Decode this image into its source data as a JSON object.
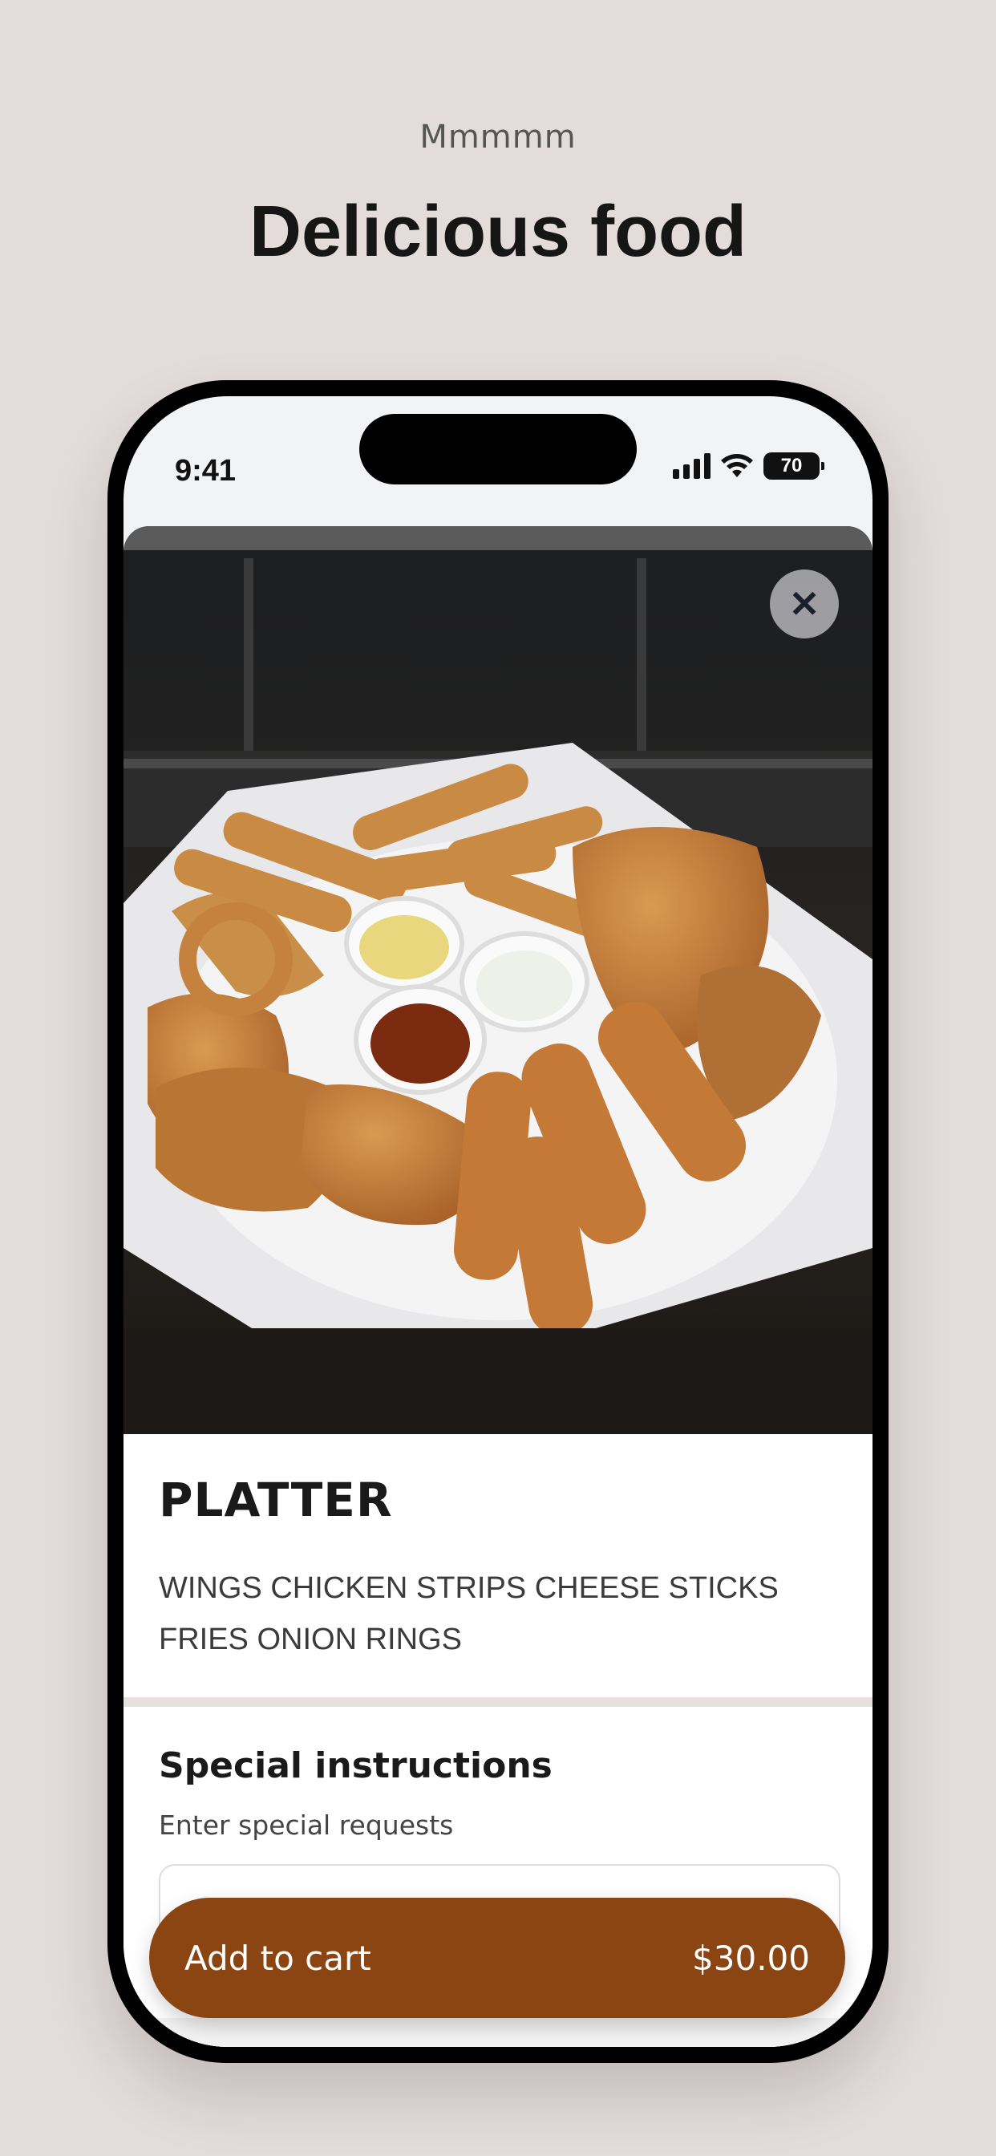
{
  "header": {
    "subtitle": "Mmmmm",
    "title": "Delicious food"
  },
  "status_bar": {
    "time": "9:41",
    "battery": "70"
  },
  "item": {
    "title": "PLATTER",
    "description": "WINGS CHICKEN STRIPS CHEESE STICKS FRIES ONION RINGS"
  },
  "special_instructions": {
    "title": "Special instructions",
    "subtitle": "Enter special requests"
  },
  "cart": {
    "label": "Add to cart",
    "price": "$30.00"
  },
  "colors": {
    "background": "#e4dcda",
    "accent": "#8b4513"
  }
}
